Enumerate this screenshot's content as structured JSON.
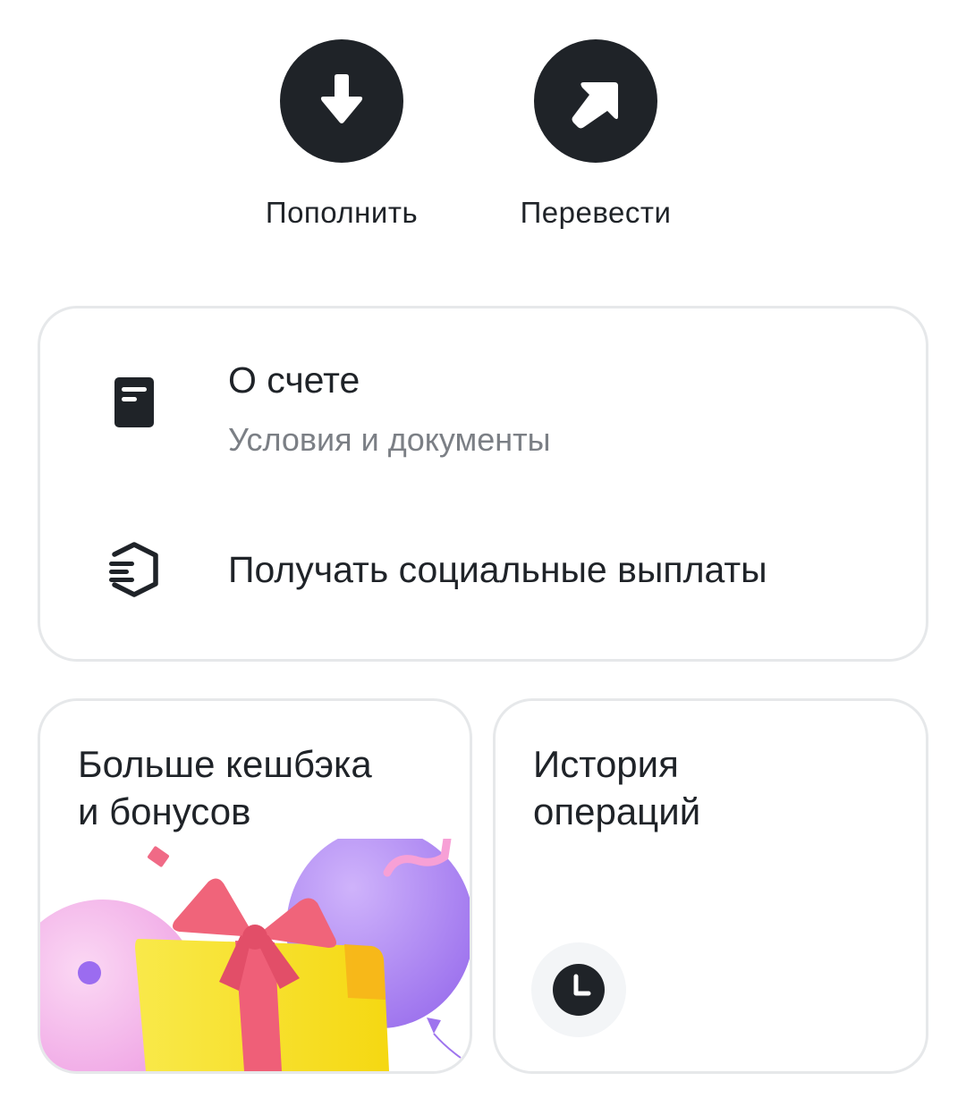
{
  "actions": {
    "topup": {
      "label": "Пополнить",
      "icon": "arrow-down-icon"
    },
    "transfer": {
      "label": "Перевести",
      "icon": "arrow-up-right-icon"
    }
  },
  "account_menu": {
    "about": {
      "title": "О счете",
      "subtitle": "Условия и документы",
      "icon": "document-icon"
    },
    "social": {
      "title": "Получать социальные выплаты",
      "icon": "social-payments-icon"
    }
  },
  "tiles": {
    "cashback": {
      "title": "Больше кешбэка\nи бонусов",
      "illustration": "gift-balloons-illustration"
    },
    "history": {
      "title": "История\nопераций",
      "icon": "clock-icon"
    }
  },
  "colors": {
    "primary": "#1f2328",
    "secondary_text": "#7b7f85",
    "card_border": "#e6e8ea",
    "icon_background": "#f3f5f7",
    "balloon_purple": "#b58cf5",
    "balloon_pink": "#f7c6ef",
    "gift_yellow": "#f7e21f",
    "ribbon_red": "#f0647a"
  }
}
